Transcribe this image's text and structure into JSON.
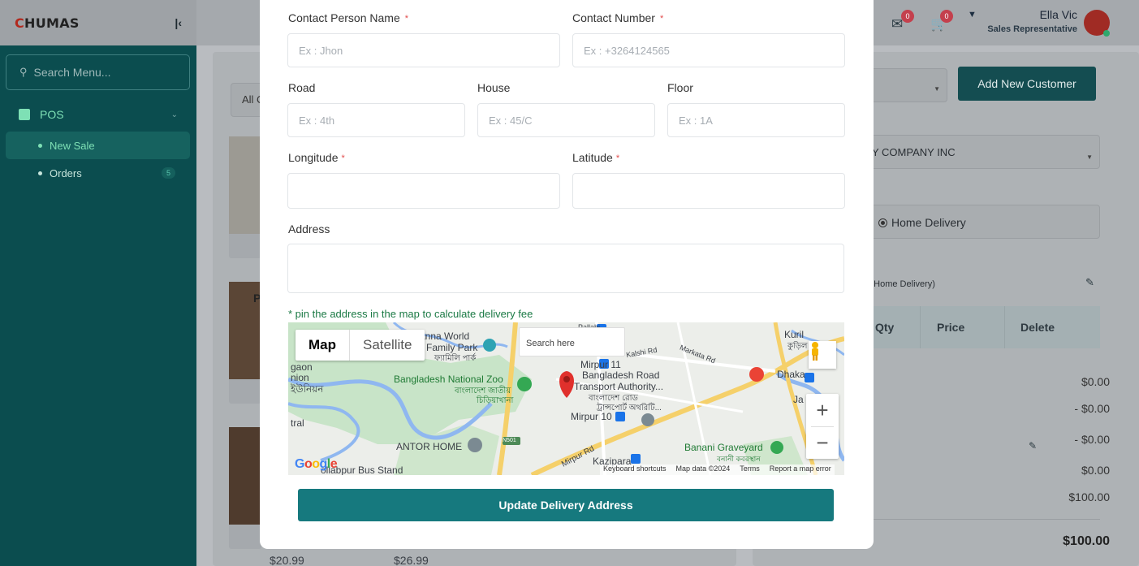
{
  "sidebar": {
    "logo_initial": "C",
    "logo_rest": "HUMAS",
    "search_placeholder": "Search Menu...",
    "pos_label": "POS",
    "items": [
      {
        "label": "New Sale"
      },
      {
        "label": "Orders",
        "count": "5"
      }
    ]
  },
  "header": {
    "notification_count": "0",
    "cart_count": "0",
    "user_name": "Ella Vic",
    "user_role": "Sales Representative"
  },
  "background": {
    "category_select": "All C",
    "product_letter": "P",
    "prices": [
      "$20.99",
      "$26.99"
    ],
    "add_customer_label": "Add New Customer",
    "customer_value": "Y COMPANY INC",
    "delivery_option": "Home Delivery",
    "delivery_note": "i (Home Delivery)",
    "cart_columns": [
      "Qty",
      "Price",
      "Delete"
    ],
    "summary_values": [
      "$0.00",
      "- $0.00",
      "- $0.00",
      "$0.00",
      "$100.00"
    ],
    "summary_colon": ":",
    "total": "$100.00"
  },
  "modal": {
    "contact_name_label": "Contact Person Name",
    "contact_name_placeholder": "Ex : Jhon",
    "contact_number_label": "Contact Number",
    "contact_number_placeholder": "Ex : +3264124565",
    "road_label": "Road",
    "road_placeholder": "Ex : 4th",
    "house_label": "House",
    "house_placeholder": "Ex : 45/C",
    "floor_label": "Floor",
    "floor_placeholder": "Ex : 1A",
    "longitude_label": "Longitude",
    "latitude_label": "Latitude",
    "address_label": "Address",
    "required_mark": "*",
    "pin_note": "* pin the address in the map to calculate delivery fee",
    "update_button": "Update Delivery Address"
  },
  "map": {
    "tab_map": "Map",
    "tab_satellite": "Satellite",
    "search_placeholder": "Search here",
    "labels": {
      "family_park_1": "anna World",
      "family_park_2": "Family Park",
      "family_park_bn": "ফ্যামিলি পার্ক",
      "zoo": "Bangladesh National Zoo",
      "zoo_bn_1": "বাংলাদেশ জাতীয়",
      "zoo_bn_2": "চিড়িয়াখানা",
      "mirpur11": "Mirpur 11",
      "mirpur10": "Mirpur 10",
      "brta_1": "Bangladesh Road",
      "brta_2": "Transport Authority...",
      "brta_bn_1": "বাংলাদেশ রোড",
      "brta_bn_2": "ট্রান্সপোর্ট অথরিটি...",
      "gaon": "gaon",
      "union": "nion",
      "union_bn": "ইউনিয়ন",
      "tral": "tral",
      "antor_home": "ANTOR HOME",
      "n501": "N501",
      "mirpur_rd": "Mirpur Rd",
      "kazipara": "Kazipara",
      "banani": "Banani Graveyard",
      "banani_bn": "বনানী কবরস্থান",
      "dhaka": "Dhaka",
      "kuril": "Kuril",
      "kuril_bn": "কুড়িল",
      "kalshi": "Kalshi Rd",
      "markata": "Markata Rd",
      "bus_stand": "ollabpur Bus Stand",
      "ja": "Ja",
      "pallabi": "Pallabi"
    },
    "google": "Google",
    "footer": [
      "Keyboard shortcuts",
      "Map data ©2024",
      "Terms",
      "Report a map error"
    ],
    "colors": {
      "water": "#8fb7f0",
      "park": "#c3e2c4",
      "road_major": "#f7d674",
      "marker": "#e0302c",
      "metro": "#1a73e8"
    }
  }
}
